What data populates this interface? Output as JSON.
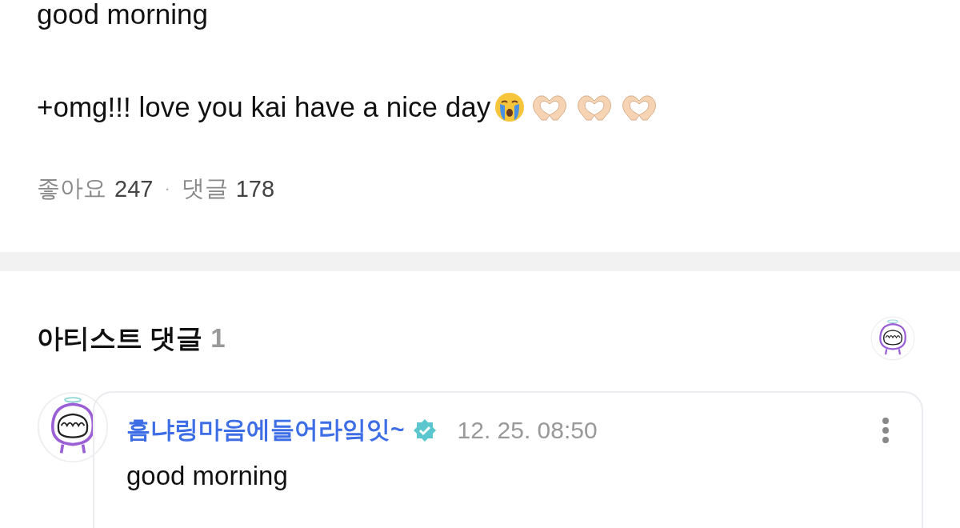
{
  "post": {
    "paragraphs": [
      "good morning",
      "+omg!!! love you kai have a nice day"
    ],
    "emojis": [
      {
        "kind": "crying"
      },
      {
        "kind": "heart-hands"
      },
      {
        "kind": "heart-hands"
      },
      {
        "kind": "heart-hands"
      }
    ],
    "stats": [
      {
        "label": "좋아요",
        "count": "247"
      },
      {
        "label": "댓글",
        "count": "178"
      }
    ],
    "separator": "·"
  },
  "artist_comments": {
    "title": "아티스트 댓글",
    "count": "1",
    "comments": [
      {
        "author": "흠냐링마음에들어라잌잇~",
        "verified": true,
        "time": "12. 25. 08:50",
        "text": "good morning"
      }
    ]
  }
}
